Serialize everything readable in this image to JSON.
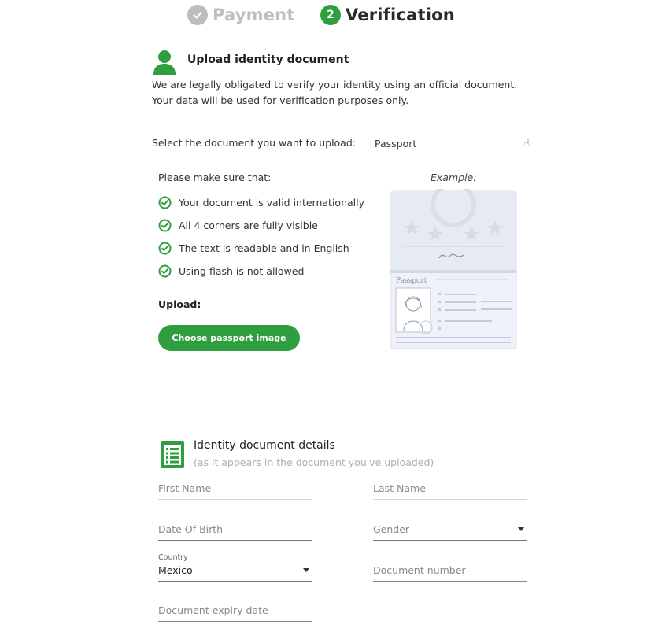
{
  "stepper": {
    "steps": [
      {
        "label": "Payment",
        "state": "done"
      },
      {
        "label": "Verification",
        "number": "2",
        "state": "active"
      }
    ]
  },
  "upload": {
    "title": "Upload identity document",
    "desc_line1": "We are legally obligated to verify your identity using an official document.",
    "desc_line2": "Your data will be used for verification purposes only.",
    "select_label": "Select the document you want to upload:",
    "selected_doc": "Passport",
    "checks_title": "Please make sure that:",
    "checks": [
      "Your document is valid internationally",
      "All 4 corners are fully visible",
      "The text is readable and in English",
      "Using flash is not allowed"
    ],
    "upload_label": "Upload:",
    "button_label": "Choose passport image",
    "example_label": "Example:",
    "example_doc_label": "Passport"
  },
  "details": {
    "title": "Identity document details",
    "subtitle": "(as it appears in the document you've uploaded)",
    "first_name_placeholder": "First Name",
    "last_name_placeholder": "Last Name",
    "dob_placeholder": "Date Of Birth",
    "gender_placeholder": "Gender",
    "country_label": "Country",
    "country_value": "Mexico",
    "doc_number_placeholder": "Document number",
    "expiry_placeholder": "Document expiry date"
  },
  "colors": {
    "accent": "#2e9e3e",
    "done_gray": "#bdbdbd"
  }
}
